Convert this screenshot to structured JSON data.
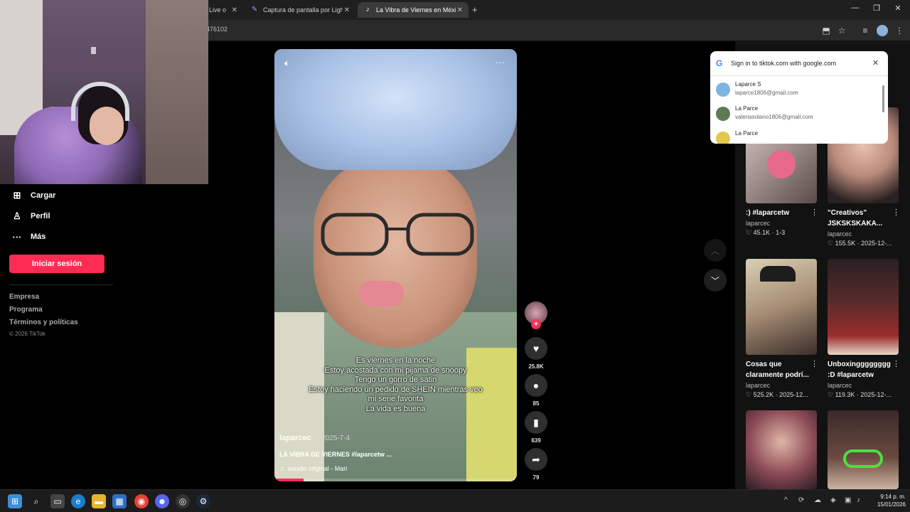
{
  "browser": {
    "tabs": [
      {
        "label": "Live o",
        "icon": "tab-icon"
      },
      {
        "label": "Captura de pantalla por Lights",
        "icon": "feather-icon"
      },
      {
        "label": "La Vibra de Viernes en México",
        "icon": "tiktok-icon",
        "active": true
      }
    ],
    "new_tab": "+",
    "url": "476102",
    "window_controls": {
      "minimize": "—",
      "restore": "❐",
      "close": "✕"
    }
  },
  "sidebar": {
    "items": [
      {
        "label": "Cargar",
        "icon": "upload-icon"
      },
      {
        "label": "Perfil",
        "icon": "profile-icon"
      },
      {
        "label": "Más",
        "icon": "more-icon"
      }
    ],
    "login_button": "Iniciar sesión",
    "footer_links": [
      "Empresa",
      "Programa",
      "Términos y políticas"
    ],
    "copyright": "© 2026 TikTok"
  },
  "video": {
    "caption_lines": [
      "Es viernes en la noche",
      "Estoy acostada con mi pijama de snoopy",
      "Tengo un gorro de satin",
      "Estoy haciendo un pedido de SHEIN mientras veo",
      "mi serie favorita",
      "La vida es buena"
    ],
    "author": "laparcec",
    "date": "· 2025-7-4",
    "description": "LA VIBRA DE VIERNES #laparcetw ...",
    "sound": "sonido original - Mari",
    "progress": 0.12
  },
  "actions": {
    "likes": "25.8K",
    "comments": "85",
    "saves": "639",
    "shares": "79",
    "follow": "+"
  },
  "google_popup": {
    "logo": "G",
    "title": "Sign in to tiktok.com with google.com",
    "close": "✕",
    "accounts": [
      {
        "name": "Laparce S",
        "email": "laparce1806@gmail.com"
      },
      {
        "name": "La Parce",
        "email": "valeriasolano1806@gmail.com"
      },
      {
        "name": "La Parce",
        "email": ""
      }
    ]
  },
  "feed": {
    "cards": [
      {
        "title": ":) #laparcetw",
        "user": "laparcec",
        "meta": "♡ 45.1K · 1-3"
      },
      {
        "title": "\"Creativos\" JSKSKSKAKA...",
        "user": "laparcec",
        "meta": "♡ 155.5K · 2025-12-..."
      },
      {
        "title": "Cosas que claramente podrí...",
        "user": "laparcec",
        "meta": "♡ 525.2K · 2025-12..."
      },
      {
        "title": "Unboxingggggggg :D #laparcetw",
        "user": "laparcec",
        "meta": "♡ 119.3K · 2025-12-..."
      }
    ],
    "more": "⋮"
  },
  "taskbar": {
    "time": "9:14 p. m.",
    "date": "15/01/2026",
    "tray_arrow": "^"
  },
  "colors": {
    "accent": "#fe2c55",
    "panel": "#121212",
    "chrome": "#1f1f1f"
  }
}
